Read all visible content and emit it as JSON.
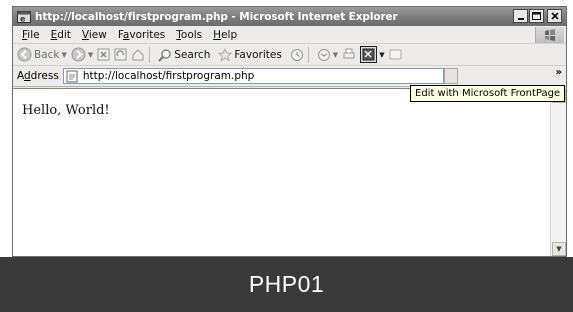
{
  "window": {
    "title": "http://localhost/firstprogram.php - Microsoft Internet Explorer",
    "controls": [
      "minimize",
      "maximize",
      "close"
    ]
  },
  "menubar": {
    "items": [
      {
        "label": "File",
        "accel": "F",
        "rest": "ile"
      },
      {
        "label": "Edit",
        "accel": "E",
        "rest": "dit"
      },
      {
        "label": "View",
        "accel": "V",
        "rest": "iew"
      },
      {
        "label": "Favorites",
        "accel_pre": "F",
        "accel": "a",
        "rest": "vorites"
      },
      {
        "label": "Tools",
        "accel": "T",
        "rest": "ools"
      },
      {
        "label": "Help",
        "accel": "H",
        "rest": "elp"
      }
    ]
  },
  "toolbar": {
    "back_label": "Back",
    "search_label": "Search",
    "favorites_label": "Favorites"
  },
  "address": {
    "label_accel": "d",
    "label_pre": "A",
    "label_post": "dress",
    "url": "http://localhost/firstprogram.php"
  },
  "tooltip": {
    "text": "Edit with Microsoft FrontPage"
  },
  "content": {
    "text": "Hello, World!"
  },
  "caption": {
    "text": "PHP01"
  },
  "colors": {
    "titlebar": "#7e7e7e",
    "chrome": "#ecebe7",
    "tooltip_bg": "#ffffe1",
    "caption_bg": "#3a3a3a"
  }
}
